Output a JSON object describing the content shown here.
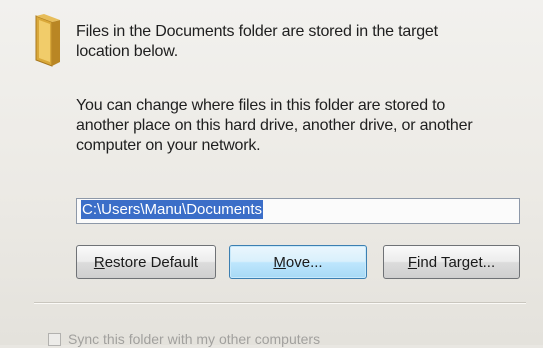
{
  "intro": {
    "line1": "Files in the Documents folder are stored in the target",
    "line2": "location below."
  },
  "description": {
    "line1": "You can change where files in this folder are stored to",
    "line2": "another place on this hard drive, another drive, or another",
    "line3": "computer on your network."
  },
  "location": {
    "path": "C:\\Users\\Manu\\Documents"
  },
  "buttons": {
    "restore_rest": "estore Default",
    "restore_mnemonic": "R",
    "move_mnemonic": "M",
    "move_rest": "ove...",
    "find_mnemonic": "F",
    "find_rest": "ind Target..."
  },
  "sync": {
    "label": "Sync this folder with my other computers"
  },
  "icons": {
    "folder": "folder-icon"
  }
}
